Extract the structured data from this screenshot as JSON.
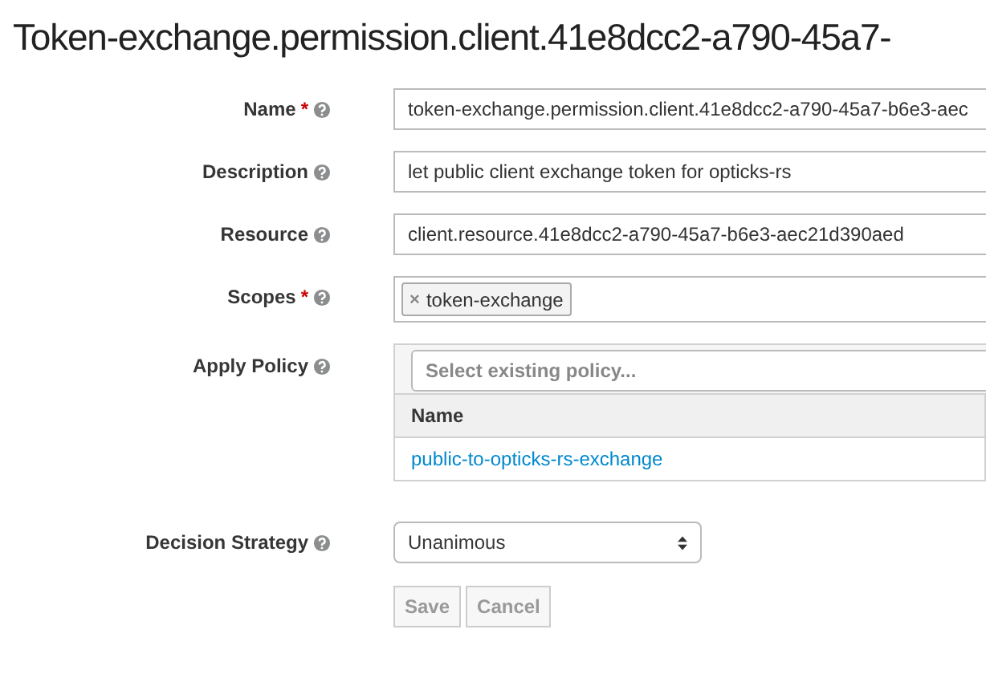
{
  "title": "Token-exchange.permission.client.41e8dcc2-a790-45a7-",
  "fields": [
    {
      "kind": "text",
      "label": "Name",
      "required_mark": "*",
      "value": "token-exchange.permission.client.41e8dcc2-a790-45a7-b6e3-aec"
    },
    {
      "kind": "text",
      "label": "Description",
      "value": "let public client exchange token for opticks-rs"
    },
    {
      "kind": "text",
      "label": "Resource",
      "value": "client.resource.41e8dcc2-a790-45a7-b6e3-aec21d390aed"
    },
    {
      "kind": "tags",
      "label": "Scopes",
      "required_mark": "*",
      "tags": [
        {
          "remove": "×",
          "label": "token-exchange"
        }
      ]
    },
    {
      "kind": "policy",
      "label": "Apply Policy",
      "placeholder": "Select existing policy...",
      "columns": [
        "Name"
      ],
      "rows": [
        "public-to-opticks-rs-exchange"
      ]
    },
    {
      "kind": "select",
      "label": "Decision Strategy",
      "value": "Unanimous"
    }
  ],
  "buttons": [
    {
      "label": "Save",
      "disabled": true
    },
    {
      "label": "Cancel",
      "disabled": true
    }
  ]
}
